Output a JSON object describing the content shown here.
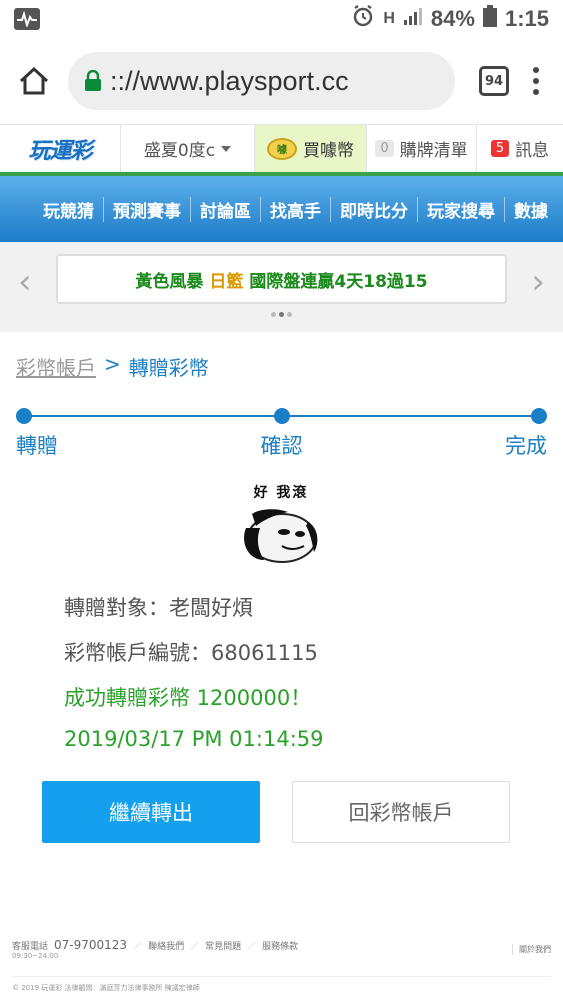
{
  "statusbar": {
    "battery": "84%",
    "time": "1:15"
  },
  "browser": {
    "url": ":://www.playsport.cc",
    "tab_count": "94"
  },
  "site_header": {
    "logo": "玩運彩",
    "user": "盛夏0度c",
    "buy_label": "買噱幣",
    "buy_coin_text": "噱",
    "cart_count": "0",
    "cart_label": "購牌清單",
    "msg_count": "5",
    "msg_label": "訊息"
  },
  "nav": {
    "items": [
      "玩競猜",
      "預測賽事",
      "討論區",
      "找高手",
      "即時比分",
      "玩家搜尋",
      "數據"
    ]
  },
  "marquee": {
    "part_a": "黃色風暴",
    "part_b": "日籃",
    "part_c": "國際盤連贏4天18過15"
  },
  "breadcrumb": {
    "parent": "彩幣帳戶",
    "separator": ">",
    "current": "轉贈彩幣"
  },
  "steps": [
    "轉贈",
    "確認",
    "完成"
  ],
  "meme": {
    "caption": "好 我滾"
  },
  "result": {
    "recipient": "轉贈對象：老闆好煩",
    "account": "彩幣帳戶編號：68061115",
    "success": "成功轉贈彩幣 1200000！",
    "datetime": "2019/03/17 PM 01:14:59"
  },
  "buttons": {
    "continue": "繼續轉出",
    "back": "回彩幣帳戶"
  },
  "footer": {
    "service_label": "客服電話",
    "service_phone": "07-9700123",
    "hours": "09:30~24:00",
    "links": [
      "聯絡我們",
      "常見問題",
      "服務條款"
    ],
    "about": "關於我們",
    "copyright": "© 2019 玩運彩 法律顧問：滿庭芳力法律事務所 陳議宏律師"
  },
  "colors": {
    "accent_blue": "#1a7fc6",
    "button_blue": "#14a0ef",
    "success_green": "#2aa22a",
    "header_green": "#3aa24a"
  }
}
